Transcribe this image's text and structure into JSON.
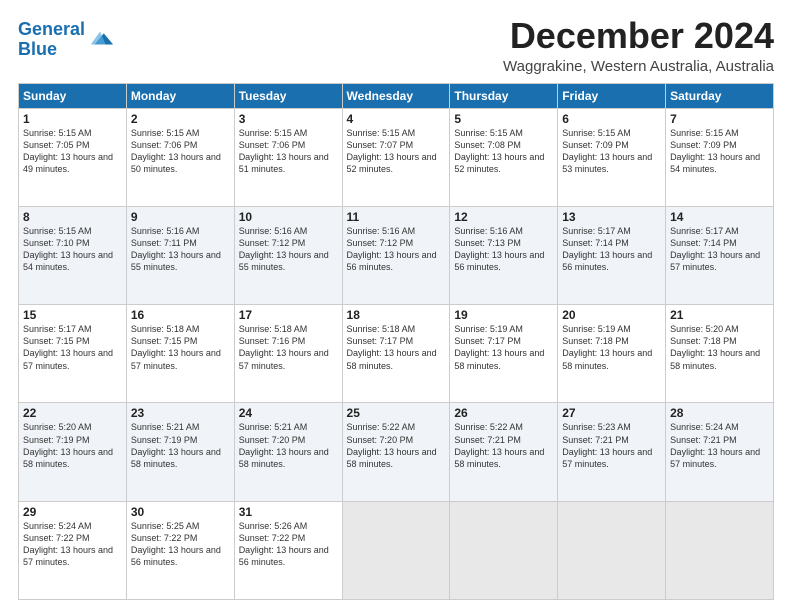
{
  "logo": {
    "line1": "General",
    "line2": "Blue"
  },
  "title": "December 2024",
  "subtitle": "Waggrakine, Western Australia, Australia",
  "headers": [
    "Sunday",
    "Monday",
    "Tuesday",
    "Wednesday",
    "Thursday",
    "Friday",
    "Saturday"
  ],
  "weeks": [
    [
      {
        "day": "1",
        "sunrise": "5:15 AM",
        "sunset": "7:05 PM",
        "daylight": "13 hours and 49 minutes."
      },
      {
        "day": "2",
        "sunrise": "5:15 AM",
        "sunset": "7:06 PM",
        "daylight": "13 hours and 50 minutes."
      },
      {
        "day": "3",
        "sunrise": "5:15 AM",
        "sunset": "7:06 PM",
        "daylight": "13 hours and 51 minutes."
      },
      {
        "day": "4",
        "sunrise": "5:15 AM",
        "sunset": "7:07 PM",
        "daylight": "13 hours and 52 minutes."
      },
      {
        "day": "5",
        "sunrise": "5:15 AM",
        "sunset": "7:08 PM",
        "daylight": "13 hours and 52 minutes."
      },
      {
        "day": "6",
        "sunrise": "5:15 AM",
        "sunset": "7:09 PM",
        "daylight": "13 hours and 53 minutes."
      },
      {
        "day": "7",
        "sunrise": "5:15 AM",
        "sunset": "7:09 PM",
        "daylight": "13 hours and 54 minutes."
      }
    ],
    [
      {
        "day": "8",
        "sunrise": "5:15 AM",
        "sunset": "7:10 PM",
        "daylight": "13 hours and 54 minutes."
      },
      {
        "day": "9",
        "sunrise": "5:16 AM",
        "sunset": "7:11 PM",
        "daylight": "13 hours and 55 minutes."
      },
      {
        "day": "10",
        "sunrise": "5:16 AM",
        "sunset": "7:12 PM",
        "daylight": "13 hours and 55 minutes."
      },
      {
        "day": "11",
        "sunrise": "5:16 AM",
        "sunset": "7:12 PM",
        "daylight": "13 hours and 56 minutes."
      },
      {
        "day": "12",
        "sunrise": "5:16 AM",
        "sunset": "7:13 PM",
        "daylight": "13 hours and 56 minutes."
      },
      {
        "day": "13",
        "sunrise": "5:17 AM",
        "sunset": "7:14 PM",
        "daylight": "13 hours and 56 minutes."
      },
      {
        "day": "14",
        "sunrise": "5:17 AM",
        "sunset": "7:14 PM",
        "daylight": "13 hours and 57 minutes."
      }
    ],
    [
      {
        "day": "15",
        "sunrise": "5:17 AM",
        "sunset": "7:15 PM",
        "daylight": "13 hours and 57 minutes."
      },
      {
        "day": "16",
        "sunrise": "5:18 AM",
        "sunset": "7:15 PM",
        "daylight": "13 hours and 57 minutes."
      },
      {
        "day": "17",
        "sunrise": "5:18 AM",
        "sunset": "7:16 PM",
        "daylight": "13 hours and 57 minutes."
      },
      {
        "day": "18",
        "sunrise": "5:18 AM",
        "sunset": "7:17 PM",
        "daylight": "13 hours and 58 minutes."
      },
      {
        "day": "19",
        "sunrise": "5:19 AM",
        "sunset": "7:17 PM",
        "daylight": "13 hours and 58 minutes."
      },
      {
        "day": "20",
        "sunrise": "5:19 AM",
        "sunset": "7:18 PM",
        "daylight": "13 hours and 58 minutes."
      },
      {
        "day": "21",
        "sunrise": "5:20 AM",
        "sunset": "7:18 PM",
        "daylight": "13 hours and 58 minutes."
      }
    ],
    [
      {
        "day": "22",
        "sunrise": "5:20 AM",
        "sunset": "7:19 PM",
        "daylight": "13 hours and 58 minutes."
      },
      {
        "day": "23",
        "sunrise": "5:21 AM",
        "sunset": "7:19 PM",
        "daylight": "13 hours and 58 minutes."
      },
      {
        "day": "24",
        "sunrise": "5:21 AM",
        "sunset": "7:20 PM",
        "daylight": "13 hours and 58 minutes."
      },
      {
        "day": "25",
        "sunrise": "5:22 AM",
        "sunset": "7:20 PM",
        "daylight": "13 hours and 58 minutes."
      },
      {
        "day": "26",
        "sunrise": "5:22 AM",
        "sunset": "7:21 PM",
        "daylight": "13 hours and 58 minutes."
      },
      {
        "day": "27",
        "sunrise": "5:23 AM",
        "sunset": "7:21 PM",
        "daylight": "13 hours and 57 minutes."
      },
      {
        "day": "28",
        "sunrise": "5:24 AM",
        "sunset": "7:21 PM",
        "daylight": "13 hours and 57 minutes."
      }
    ],
    [
      {
        "day": "29",
        "sunrise": "5:24 AM",
        "sunset": "7:22 PM",
        "daylight": "13 hours and 57 minutes."
      },
      {
        "day": "30",
        "sunrise": "5:25 AM",
        "sunset": "7:22 PM",
        "daylight": "13 hours and 56 minutes."
      },
      {
        "day": "31",
        "sunrise": "5:26 AM",
        "sunset": "7:22 PM",
        "daylight": "13 hours and 56 minutes."
      },
      null,
      null,
      null,
      null
    ]
  ]
}
